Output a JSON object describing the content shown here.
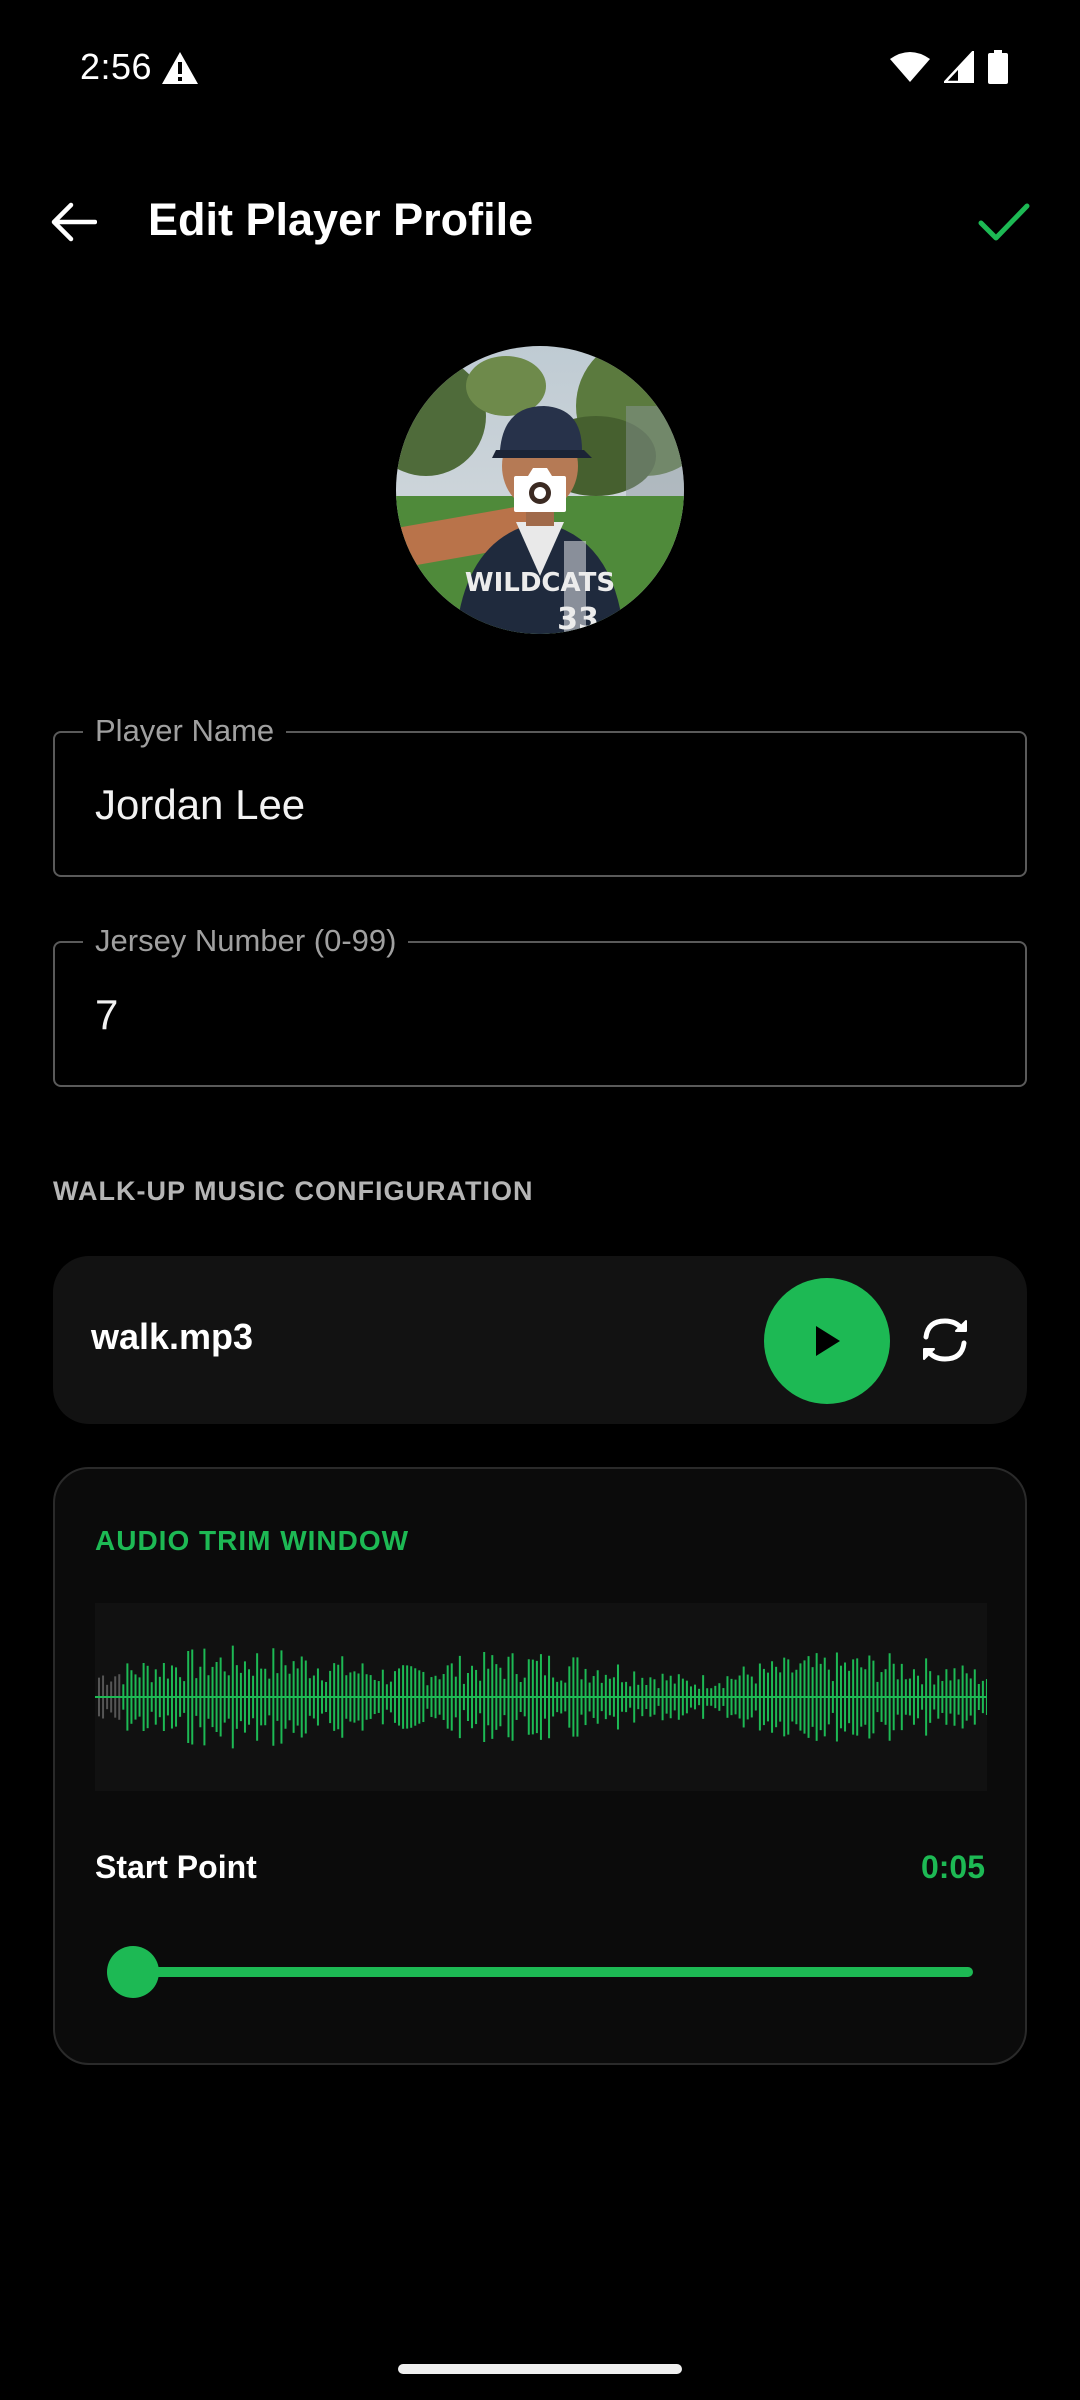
{
  "status_bar": {
    "time": "2:56",
    "icons": [
      "warning-icon",
      "wifi-icon",
      "signal-icon",
      "battery-icon"
    ]
  },
  "app_bar": {
    "title": "Edit Player Profile",
    "back_icon": "arrow-left-icon",
    "confirm_icon": "check-icon"
  },
  "avatar": {
    "overlay_icon": "camera-icon",
    "jersey_text": "WILDCATS",
    "jersey_number": "33"
  },
  "form": {
    "player_name": {
      "label": "Player Name",
      "value": "Jordan Lee"
    },
    "jersey_number": {
      "label": "Jersey Number (0-99)",
      "value": "7"
    }
  },
  "music": {
    "section_title": "WALK-UP MUSIC CONFIGURATION",
    "file_name": "walk.mp3",
    "play_icon": "play-icon",
    "replace_icon": "refresh-icon"
  },
  "trim": {
    "title": "AUDIO TRIM WINDOW",
    "start_label": "Start Point",
    "start_value": "0:05",
    "slider_position": 0.0
  },
  "colors": {
    "accent": "#1db954",
    "background": "#000000",
    "card": "#121212",
    "field_border": "#5a5a5a"
  }
}
